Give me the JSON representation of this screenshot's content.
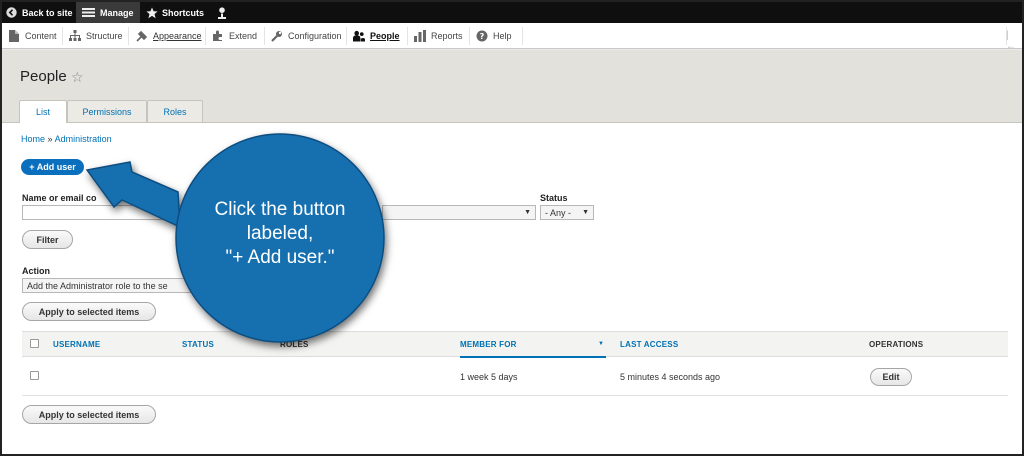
{
  "toolbar": {
    "back_label": "Back to site",
    "manage_label": "Manage",
    "shortcuts_label": "Shortcuts"
  },
  "tray": {
    "items": [
      {
        "label": "Content",
        "icon": "content-icon"
      },
      {
        "label": "Structure",
        "icon": "structure-icon"
      },
      {
        "label": "Appearance",
        "icon": "appearance-icon"
      },
      {
        "label": "Extend",
        "icon": "extend-icon"
      },
      {
        "label": "Configuration",
        "icon": "wrench-icon"
      },
      {
        "label": "People",
        "icon": "people-icon"
      },
      {
        "label": "Reports",
        "icon": "reports-icon"
      },
      {
        "label": "Help",
        "icon": "help-icon"
      }
    ],
    "collapse_glyph": "|←"
  },
  "header": {
    "title": "People",
    "star": "☆",
    "tabs": [
      {
        "label": "List"
      },
      {
        "label": "Permissions"
      },
      {
        "label": "Roles"
      }
    ]
  },
  "breadcrumb": {
    "home": "Home",
    "separator": "»",
    "admin": "Administration"
  },
  "add_user_label": "+ Add user",
  "filters": {
    "name_label": "Name or email co",
    "status_label": "Status",
    "status_value": "- Any -",
    "filter_label": "Filter"
  },
  "action": {
    "label": "Action",
    "value": "Add the Administrator role to the se",
    "apply_label": "Apply to selected items"
  },
  "table": {
    "headers": {
      "username": "USERNAME",
      "status": "STATUS",
      "roles": "ROLES",
      "member_for": "MEMBER FOR",
      "last_access": "LAST ACCESS",
      "operations": "OPERATIONS"
    },
    "rows": [
      {
        "member_for": "1 week 5 days",
        "last_access": "5 minutes 4 seconds ago",
        "edit_label": "Edit"
      }
    ]
  },
  "callout": {
    "line1": "Click the button",
    "line2": "labeled,",
    "line3": "\"+ Add user.\""
  },
  "colors": {
    "accent": "#0071b3",
    "callout_fill": "#1470b0",
    "header_bg": "#e2e1dc"
  }
}
